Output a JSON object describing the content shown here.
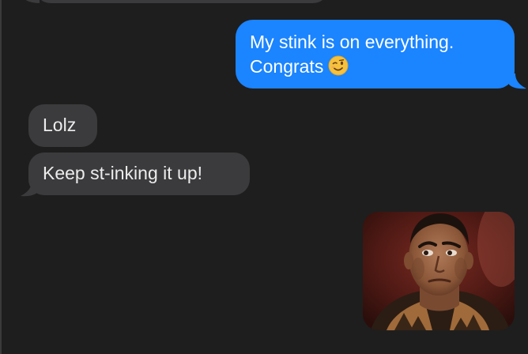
{
  "conversation": {
    "messages": [
      {
        "sender": "other",
        "text": ""
      },
      {
        "sender": "me",
        "line1": "My stink is on everything.",
        "line2": "Congrats",
        "emoji": "winking-face"
      },
      {
        "sender": "other",
        "text": "Lolz"
      },
      {
        "sender": "other",
        "text": "Keep st-inking it up!"
      },
      {
        "sender": "me",
        "attachment": "photo"
      }
    ]
  },
  "colors": {
    "background": "#1e1e1e",
    "incoming_bubble": "#3b3b3d",
    "outgoing_bubble": "#1b84ff"
  }
}
